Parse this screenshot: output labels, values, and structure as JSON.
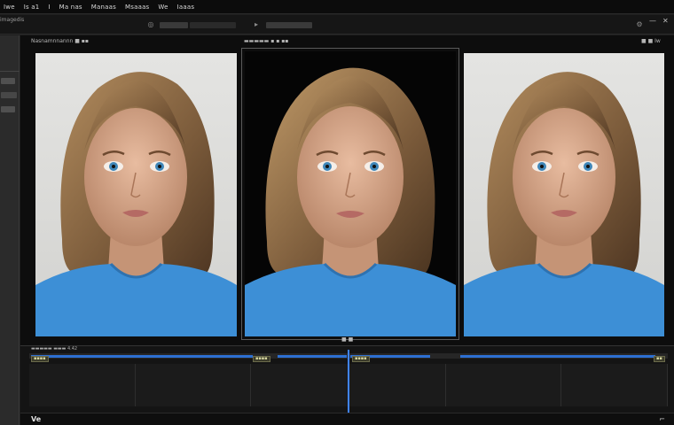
{
  "menubar": {
    "items": [
      "Iwe",
      "Is a1",
      "I",
      "Ma nas",
      "Manaas",
      "Msaaas",
      "We",
      "Iaaas"
    ]
  },
  "toolbar": {
    "left_text": "imagedis",
    "window_buttons": [
      "—",
      "✕"
    ]
  },
  "viewer": {
    "panels": [
      {
        "header": "Nasnamnnannn  ■ ▪▪",
        "tone": "light"
      },
      {
        "header": "▬▬▬▬▬  ▪ ▪ ▪▪",
        "tone": "dark"
      },
      {
        "header": "■ ■  Iw",
        "tone": "light"
      }
    ],
    "center_footer": "■ ■",
    "right_top_icons": [
      "◐",
      "≡"
    ]
  },
  "timeline": {
    "header_text": "▬▬▬▬▬ ▬▬▬ 4.42",
    "clip_tags": [
      "▪▪▪▪",
      "▪▪▪▪",
      "▪▪▪▪",
      "▪▪"
    ],
    "bottom_label": "Ve",
    "bottom_icon": "⌐"
  },
  "colors": {
    "shirt": "#3d8fd6",
    "hair": "#8a6a45",
    "skin": "#d9a98a",
    "playhead": "#3f83ff",
    "clip_bar": "#2d6fd1"
  }
}
